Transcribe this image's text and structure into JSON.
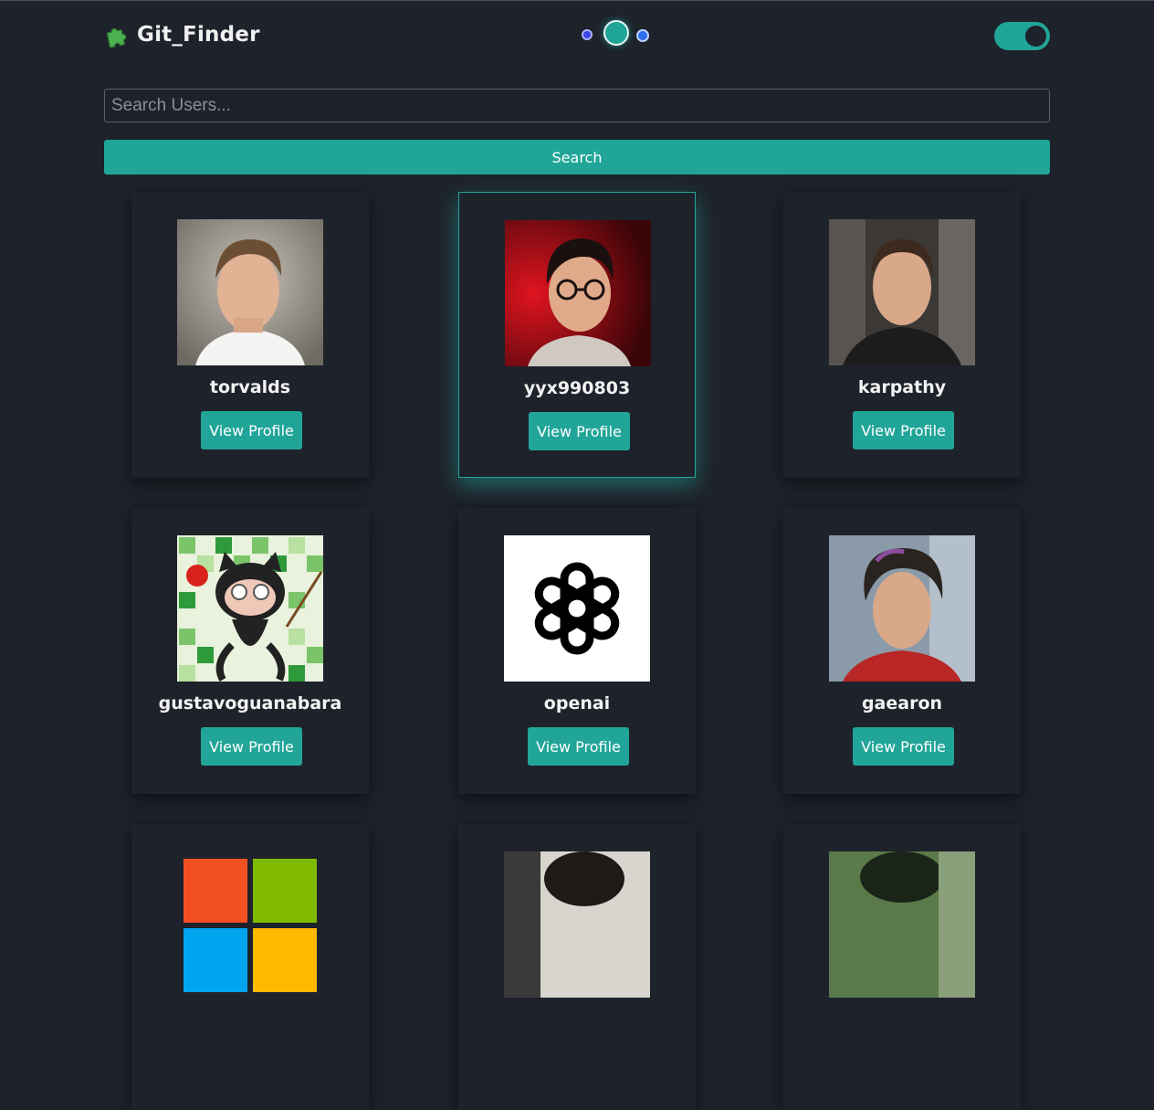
{
  "app": {
    "title": "Git_Finder",
    "logo_icon": "puzzle-piece-icon",
    "accent_color": "#21a598",
    "background_color": "#1e222b",
    "theme_toggle_on": true
  },
  "search": {
    "placeholder": "Search Users...",
    "value": "",
    "button_label": "Search"
  },
  "users": [
    {
      "login": "torvalds",
      "button_label": "View Profile",
      "avatar": "portrait-photo"
    },
    {
      "login": "yyx990803",
      "button_label": "View Profile",
      "avatar": "portrait-photo"
    },
    {
      "login": "karpathy",
      "button_label": "View Profile",
      "avatar": "portrait-photo"
    },
    {
      "login": "gustavoguanabara",
      "button_label": "View Profile",
      "avatar": "octocat-illustration"
    },
    {
      "login": "openai",
      "button_label": "View Profile",
      "avatar": "openai-logo"
    },
    {
      "login": "gaearon",
      "button_label": "View Profile",
      "avatar": "portrait-photo"
    },
    {
      "login": "",
      "button_label": "",
      "avatar": "microsoft-logo"
    },
    {
      "login": "",
      "button_label": "",
      "avatar": "portrait-photo"
    },
    {
      "login": "",
      "button_label": "",
      "avatar": "portrait-photo"
    }
  ]
}
